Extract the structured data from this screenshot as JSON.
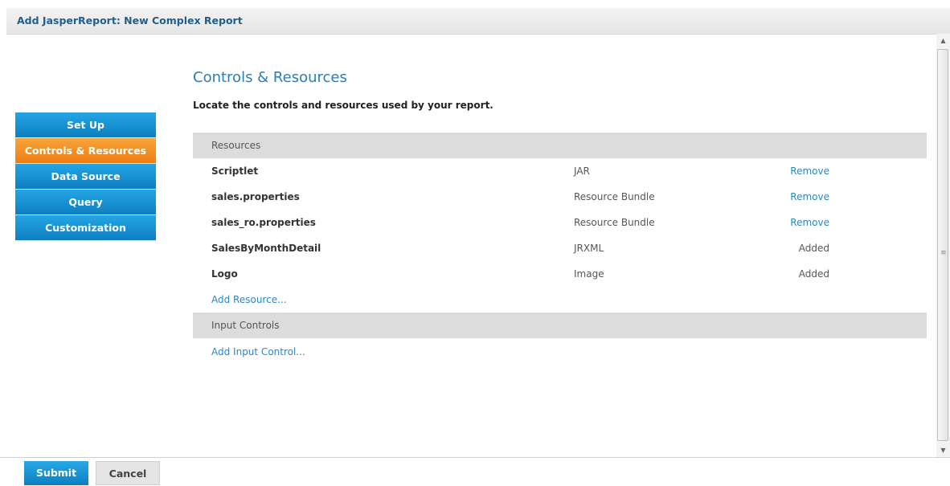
{
  "window": {
    "title": "Add JasperReport: New Complex Report"
  },
  "wizard_steps": [
    {
      "label": "Set Up",
      "active": false
    },
    {
      "label": "Controls & Resources",
      "active": true
    },
    {
      "label": "Data Source",
      "active": false
    },
    {
      "label": "Query",
      "active": false
    },
    {
      "label": "Customization",
      "active": false
    }
  ],
  "main": {
    "heading": "Controls & Resources",
    "subheading": "Locate the controls and resources used by your report.",
    "resources_header": "Resources",
    "resources": [
      {
        "name": "Scriptlet",
        "type": "JAR",
        "action": "Remove"
      },
      {
        "name": "sales.properties",
        "type": "Resource Bundle",
        "action": "Remove"
      },
      {
        "name": "sales_ro.properties",
        "type": "Resource Bundle",
        "action": "Remove"
      },
      {
        "name": "SalesByMonthDetail",
        "type": "JRXML",
        "action": "Added"
      },
      {
        "name": "Logo",
        "type": "Image",
        "action": "Added"
      }
    ],
    "add_resource": "Add Resource...",
    "input_controls_header": "Input Controls",
    "add_input_control": "Add Input Control..."
  },
  "footer": {
    "submit": "Submit",
    "cancel": "Cancel"
  },
  "colors": {
    "accent_blue": "#1a90d2",
    "active_orange": "#f28c28",
    "link": "#2b86c4"
  }
}
